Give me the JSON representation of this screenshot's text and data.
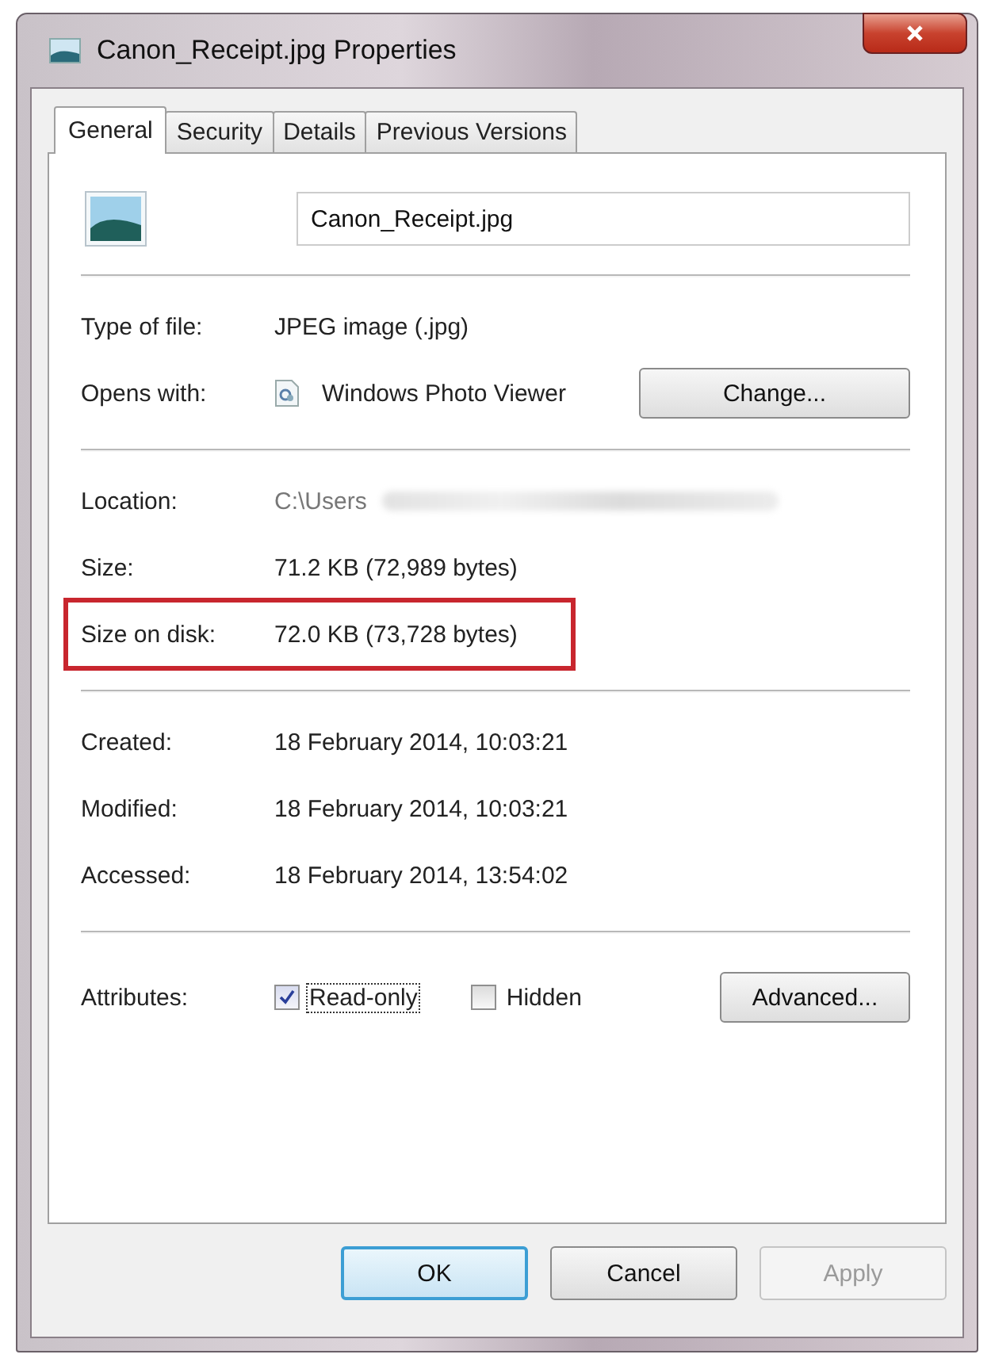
{
  "window": {
    "title": "Canon_Receipt.jpg Properties"
  },
  "tabs": [
    {
      "label": "General",
      "selected": true
    },
    {
      "label": "Security",
      "selected": false
    },
    {
      "label": "Details",
      "selected": false
    },
    {
      "label": "Previous Versions",
      "selected": false
    }
  ],
  "file_name": {
    "value": "Canon_Receipt.jpg"
  },
  "sections": [
    {
      "rows": [
        {
          "label": "Type of file:",
          "value": "JPEG image (.jpg)"
        },
        {
          "label": "Opens with:",
          "value": "Windows Photo Viewer",
          "kind": "app",
          "button": "Change..."
        }
      ]
    },
    {
      "rows": [
        {
          "label": "Location:",
          "value": "C:\\Users",
          "kind": "redacted"
        },
        {
          "label": "Size:",
          "value": "71.2 KB (72,989 bytes)"
        },
        {
          "label": "Size on disk:",
          "value": "72.0 KB (73,728 bytes)",
          "highlighted": true
        }
      ]
    },
    {
      "rows": [
        {
          "label": "Created:",
          "value": "18 February 2014, 10:03:21"
        },
        {
          "label": "Modified:",
          "value": "18 February 2014, 10:03:21"
        },
        {
          "label": "Accessed:",
          "value": "18 February 2014, 13:54:02"
        }
      ]
    }
  ],
  "attributes": {
    "label": "Attributes:",
    "checkboxes": [
      {
        "label": "Read-only",
        "checked": true,
        "focused": true
      },
      {
        "label": "Hidden",
        "checked": false,
        "focused": false
      }
    ],
    "button": "Advanced..."
  },
  "buttons": [
    {
      "label": "OK",
      "default": true,
      "disabled": false
    },
    {
      "label": "Cancel",
      "default": false,
      "disabled": false
    },
    {
      "label": "Apply",
      "default": false,
      "disabled": true
    }
  ]
}
